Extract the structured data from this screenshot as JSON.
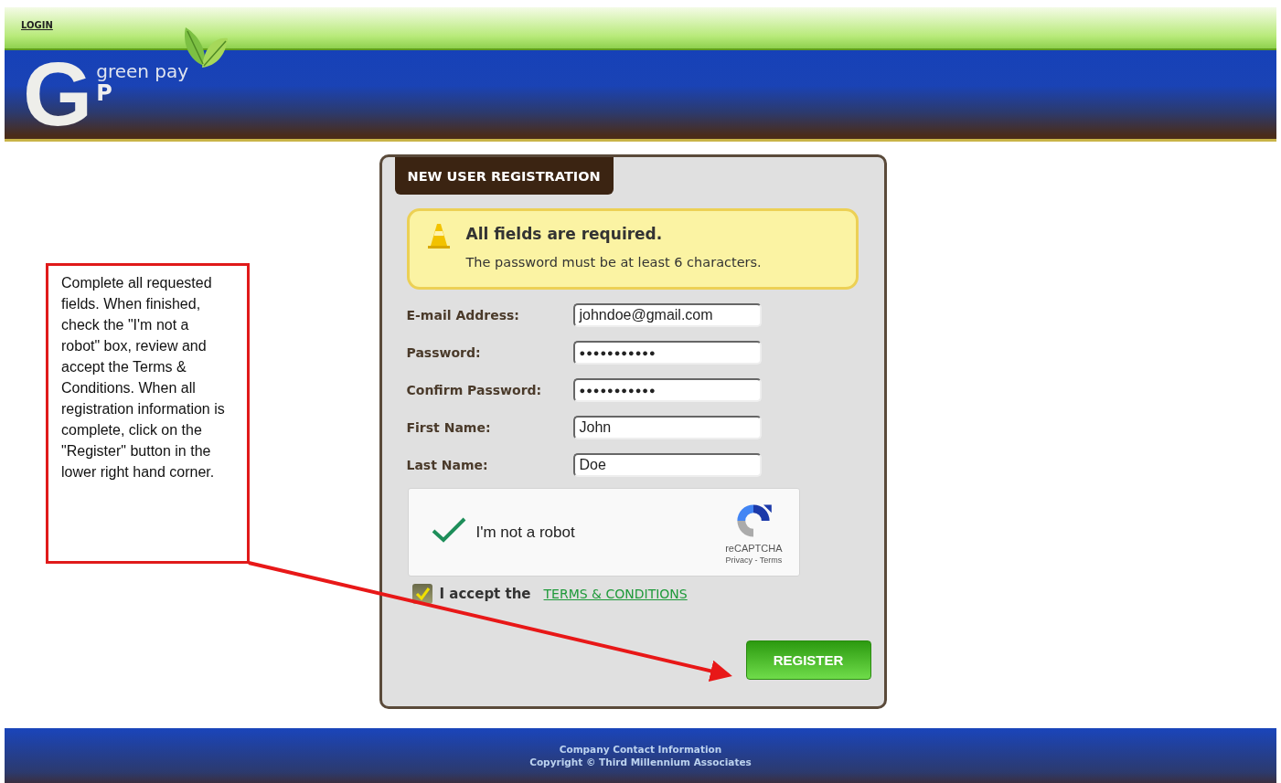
{
  "top_bar": {
    "login_link": "LOGIN"
  },
  "logo": {
    "monogram_big": "G",
    "brand": "green pay",
    "monogram_small": "P"
  },
  "form": {
    "title": "NEW USER REGISTRATION",
    "notice": {
      "heading": "All fields are required.",
      "text": "The password must be at least 6 characters."
    },
    "fields": [
      {
        "label": "E-mail Address:",
        "value": "johndoe@gmail.com",
        "kind": "text"
      },
      {
        "label": "Password:",
        "value": "●●●●●●●●●●●",
        "kind": "password"
      },
      {
        "label": "Confirm Password:",
        "value": "●●●●●●●●●●●",
        "kind": "password"
      },
      {
        "label": "First Name:",
        "value": "John",
        "kind": "text"
      },
      {
        "label": "Last Name:",
        "value": "Doe",
        "kind": "text"
      }
    ],
    "captcha": {
      "label": "I'm not a robot",
      "checked": true,
      "brand": "reCAPTCHA",
      "links": "Privacy - Terms"
    },
    "terms": {
      "checked": true,
      "text": "I accept the",
      "link": "TERMS & CONDITIONS"
    },
    "submit": "REGISTER"
  },
  "callout": {
    "text": "Complete all requested fields. When finished, check the \"I'm not a robot\" box, review and accept the Terms & Conditions.  When all registration information is complete, click on the \"Register\" button in the lower right hand corner."
  },
  "footer": {
    "lines": [
      "Company Contact Information",
      "Copyright © Third Millennium Associates"
    ]
  }
}
